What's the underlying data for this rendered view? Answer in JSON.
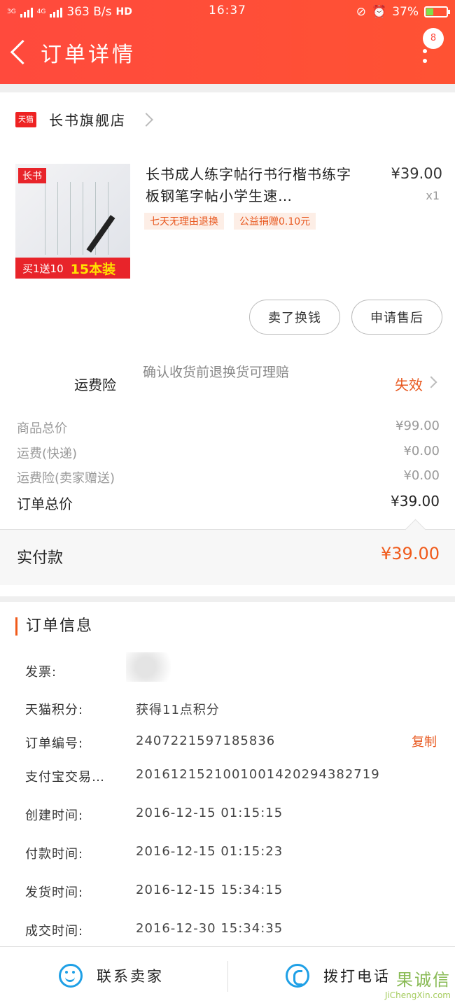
{
  "status_bar": {
    "network": "3G",
    "network2": "4G",
    "speed": "363 B/s",
    "hd": "HD",
    "time": "16:37",
    "battery": "37%",
    "battery_level": 0.37
  },
  "nav": {
    "title": "订单详情",
    "badge": "8"
  },
  "store": {
    "platform_badge": "天猫",
    "name": "长书旗舰店"
  },
  "product": {
    "image_tag": "长书",
    "image_banner": "买1送10",
    "image_banner_highlight": "15本装",
    "title": "长书成人练字帖行书行楷书练字板钢笔字帖小学生速…",
    "price": "¥39.00",
    "quantity": "x1",
    "tags": [
      "七天无理由退换",
      "公益捐赠0.10元"
    ]
  },
  "actions": {
    "refund_label": "卖了换钱",
    "after_sale_label": "申请售后"
  },
  "insurance": {
    "label": "运费险",
    "text": "确认收货前退换货可理赔",
    "status": "失效"
  },
  "summary": [
    {
      "label": "商品总价",
      "value": "¥99.00"
    },
    {
      "label": "运费(快递)",
      "value": "¥0.00"
    },
    {
      "label": "运费险(卖家赠送)",
      "value": "¥0.00"
    }
  ],
  "order_total": {
    "label": "订单总价",
    "value": "¥39.00"
  },
  "paid": {
    "label": "实付款",
    "value": "¥39.00"
  },
  "order_info": {
    "title": "订单信息",
    "rows": [
      {
        "label": "发票:",
        "value": ""
      },
      {
        "label": "天猫积分:",
        "value": "获得11点积分"
      },
      {
        "label": "订单编号:",
        "value": "2407221597185836"
      },
      {
        "label": "支付宝交易…",
        "value": "2016121521001001420294382719"
      },
      {
        "label": "创建时间:",
        "value": "2016-12-15 01:15:15"
      },
      {
        "label": "付款时间:",
        "value": "2016-12-15 01:15:23"
      },
      {
        "label": "发货时间:",
        "value": "2016-12-15 15:34:15"
      },
      {
        "label": "成交时间:",
        "value": "2016-12-30 15:34:35"
      }
    ],
    "copy_label": "复制"
  },
  "bottom_bar": {
    "contact_label": "联系卖家",
    "call_label": "拨打电话"
  },
  "watermark": {
    "text": "果诚信",
    "url": "JiChengXin.com"
  }
}
